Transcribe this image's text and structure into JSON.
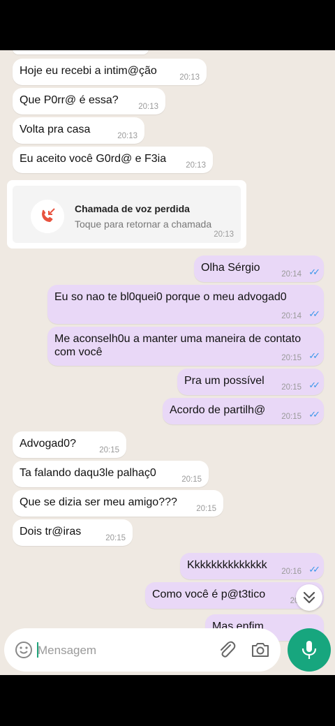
{
  "messages_in_top": [
    {
      "text": "Hoje eu recebi a intim@ção",
      "time": "20:13"
    },
    {
      "text": "Que P0rr@ é essa?",
      "time": "20:13"
    },
    {
      "text": "Volta pra casa",
      "time": "20:13"
    },
    {
      "text": "Eu aceito você G0rd@ e F3ia",
      "time": "20:13"
    }
  ],
  "missed_call": {
    "title": "Chamada de voz perdida",
    "subtitle": "Toque para retornar a chamada",
    "time": "20:13",
    "icon": "missed-call-icon",
    "accent": "#e8533f"
  },
  "messages_out": [
    {
      "text": "Olha Sérgio",
      "time": "20:14"
    },
    {
      "text": "Eu so nao te bl0quei0 porque o meu advogad0",
      "time": "20:14"
    },
    {
      "text": "Me aconselh0u a manter uma maneira de contato com você",
      "time": "20:15"
    },
    {
      "text": "Pra um possível",
      "time": "20:15"
    },
    {
      "text": "Acordo de partilh@",
      "time": "20:15"
    }
  ],
  "messages_in_bottom": [
    {
      "text": "Advogad0?",
      "time": "20:15"
    },
    {
      "text": "Ta falando daqu3le palhaç0",
      "time": "20:15"
    },
    {
      "text": "Que se dizia ser meu amigo???",
      "time": "20:15"
    },
    {
      "text": "Dois tr@iras",
      "time": "20:15"
    }
  ],
  "messages_out_bottom": [
    {
      "text": "Kkkkkkkkkkkkkk",
      "time": "20:16"
    },
    {
      "text": "Como você é p@t3tico",
      "time": "20:1"
    },
    {
      "text": "Mas enfim",
      "time": ""
    }
  ],
  "composer": {
    "placeholder": "Mensagem",
    "emoji_icon": "emoji-icon",
    "attach_icon": "paperclip-icon",
    "camera_icon": "camera-icon",
    "mic_icon": "mic-icon"
  },
  "colors": {
    "incoming_bubble": "#ffffff",
    "outgoing_bubble": "#e9d8f7",
    "read_ticks": "#3b97ea",
    "mic_button": "#17a67e",
    "chat_background": "#efe9e2"
  },
  "ticks": "✓✓"
}
